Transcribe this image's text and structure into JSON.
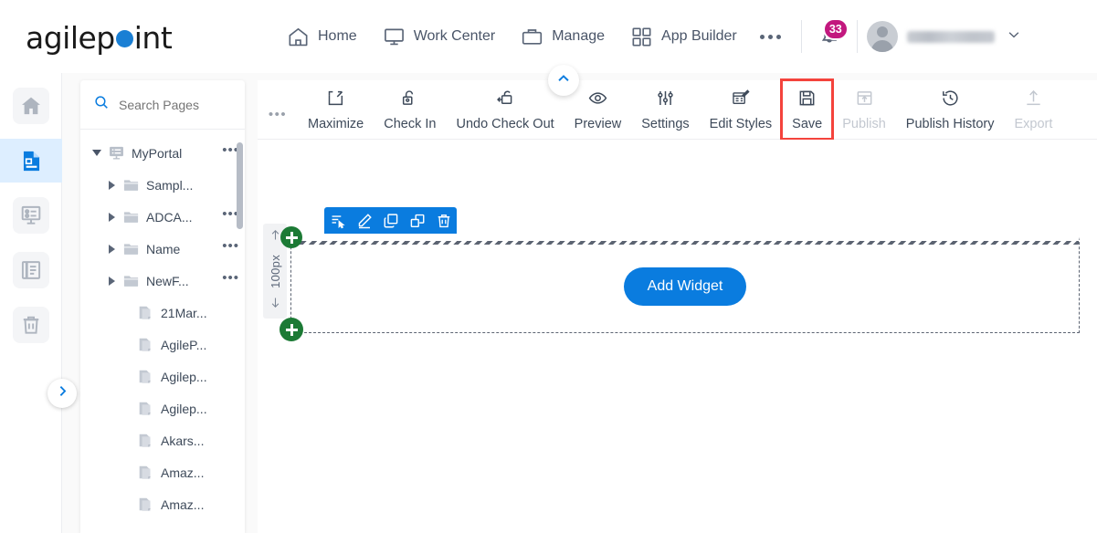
{
  "app": {
    "logo_text_a": "agilep",
    "logo_text_b": "int"
  },
  "topnav": {
    "items": [
      {
        "label": "Home",
        "icon": "home-icon"
      },
      {
        "label": "Work Center",
        "icon": "monitor-icon"
      },
      {
        "label": "Manage",
        "icon": "briefcase-icon"
      },
      {
        "label": "App Builder",
        "icon": "grid-icon"
      }
    ],
    "more_label": "•••",
    "notification_count": "33",
    "notification_icon": "bell-icon",
    "user_name": "",
    "user_chevron": "chevron-down-icon"
  },
  "rail": {
    "items": [
      {
        "name": "home",
        "icon": "home-icon",
        "active": false
      },
      {
        "name": "pages",
        "icon": "page-icon",
        "active": true
      },
      {
        "name": "forms",
        "icon": "form-icon",
        "active": false
      },
      {
        "name": "reports",
        "icon": "document-list-icon",
        "active": false
      },
      {
        "name": "recycle-bin",
        "icon": "trash-icon",
        "active": false
      }
    ],
    "expand_icon": "chevron-right-icon"
  },
  "tree_panel": {
    "search_placeholder": "Search Pages",
    "search_value": "",
    "search_icon": "search-icon",
    "nodes": [
      {
        "label": "MyPortal",
        "type": "portal",
        "expanded": true,
        "indent": 0,
        "has_menu": true
      },
      {
        "label": "Sampl...",
        "type": "folder",
        "expanded": false,
        "indent": 1,
        "has_menu": false
      },
      {
        "label": "ADCA...",
        "type": "folder",
        "expanded": false,
        "indent": 1,
        "has_menu": true
      },
      {
        "label": "Name",
        "type": "folder",
        "expanded": false,
        "indent": 1,
        "has_menu": true
      },
      {
        "label": "NewF...",
        "type": "folder",
        "expanded": false,
        "indent": 1,
        "has_menu": true
      },
      {
        "label": "21Mar...",
        "type": "page",
        "indent": 2,
        "has_menu": false
      },
      {
        "label": "AgileP...",
        "type": "page",
        "indent": 2,
        "has_menu": false
      },
      {
        "label": "Agilep...",
        "type": "page",
        "indent": 2,
        "has_menu": false
      },
      {
        "label": "Agilep...",
        "type": "page",
        "indent": 2,
        "has_menu": false
      },
      {
        "label": "Akars...",
        "type": "page",
        "indent": 2,
        "has_menu": false
      },
      {
        "label": "Amaz...",
        "type": "page",
        "indent": 2,
        "has_menu": false
      },
      {
        "label": "Amaz...",
        "type": "page",
        "indent": 2,
        "has_menu": false
      }
    ]
  },
  "toolbar": {
    "overflow_label": "•••",
    "collapse_icon": "chevron-up-icon",
    "items": [
      {
        "label": "Maximize",
        "icon": "maximize-icon",
        "disabled": false,
        "highlighted": false
      },
      {
        "label": "Check In",
        "icon": "unlock-icon",
        "disabled": false,
        "highlighted": false
      },
      {
        "label": "Undo Check Out",
        "icon": "lock-undo-icon",
        "disabled": false,
        "highlighted": false
      },
      {
        "label": "Preview",
        "icon": "eye-icon",
        "disabled": false,
        "highlighted": false
      },
      {
        "label": "Settings",
        "icon": "sliders-icon",
        "disabled": false,
        "highlighted": false
      },
      {
        "label": "Edit Styles",
        "icon": "edit-styles-icon",
        "disabled": false,
        "highlighted": false
      },
      {
        "label": "Save",
        "icon": "floppy-disk-icon",
        "disabled": false,
        "highlighted": true
      },
      {
        "label": "Publish",
        "icon": "publish-icon",
        "disabled": true,
        "highlighted": false
      },
      {
        "label": "Publish History",
        "icon": "history-icon",
        "disabled": false,
        "highlighted": false
      },
      {
        "label": "Export",
        "icon": "upload-icon",
        "disabled": true,
        "highlighted": false
      }
    ]
  },
  "canvas": {
    "row_height_label": "100px",
    "up_arrow_icon": "arrow-up-icon",
    "down_arrow_icon": "arrow-down-icon",
    "add_widget_label": "Add Widget",
    "add_row_top_icon": "plus-icon",
    "add_row_bottom_icon": "plus-icon",
    "row_toolbar": [
      {
        "name": "select-row",
        "icon": "select-icon"
      },
      {
        "name": "edit-row",
        "icon": "pencil-icon"
      },
      {
        "name": "copy-row",
        "icon": "copy-icon"
      },
      {
        "name": "duplicate-row",
        "icon": "duplicate-icon"
      },
      {
        "name": "delete-row",
        "icon": "trash-icon"
      }
    ]
  },
  "colors": {
    "brand_blue": "#0a7cdf",
    "highlight_red": "#f4433c",
    "badge_magenta": "#c2187e",
    "green_plus": "#1c7a35",
    "text_dark": "#3e4a5a",
    "text_disabled": "#c3c8d0"
  }
}
